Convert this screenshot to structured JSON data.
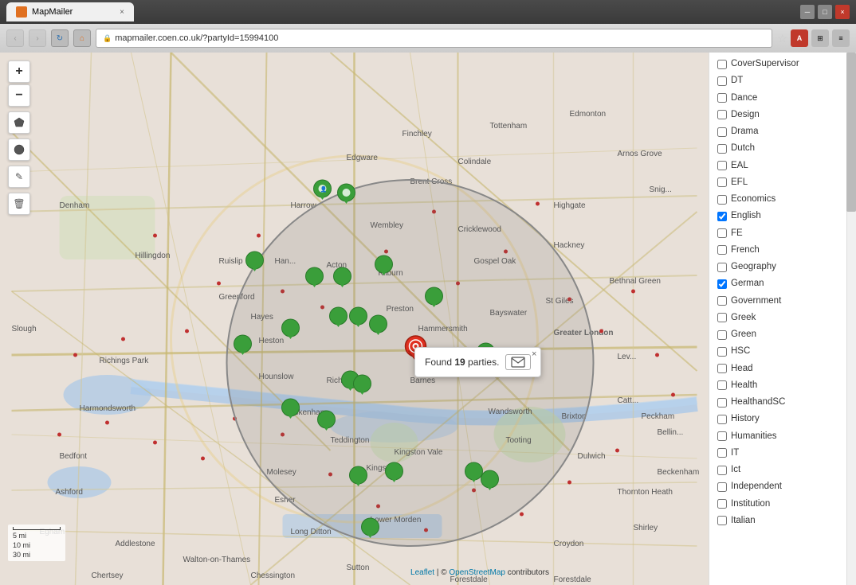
{
  "browser": {
    "tab_title": "MapMailer",
    "tab_close": "×",
    "url": "mapmailer.coen.co.uk/?partyId=15994100",
    "win_min": "─",
    "win_max": "□",
    "win_close": "×"
  },
  "map": {
    "popup": {
      "text": "Found 19 parties.",
      "close": "×"
    },
    "scale": {
      "labels": [
        "5 mi",
        "10 mi",
        "30 mi"
      ]
    },
    "attribution": {
      "leaflet": "Leaflet",
      "separator": " | © ",
      "osm": "OpenStreetMap",
      "contributors": " contributors"
    }
  },
  "sidebar": {
    "items": [
      {
        "id": "CoverSupervisor",
        "label": "CoverSupervisor",
        "checked": false
      },
      {
        "id": "DT",
        "label": "DT",
        "checked": false
      },
      {
        "id": "Dance",
        "label": "Dance",
        "checked": false
      },
      {
        "id": "Design",
        "label": "Design",
        "checked": false
      },
      {
        "id": "Drama",
        "label": "Drama",
        "checked": false
      },
      {
        "id": "Dutch",
        "label": "Dutch",
        "checked": false
      },
      {
        "id": "EAL",
        "label": "EAL",
        "checked": false
      },
      {
        "id": "EFL",
        "label": "EFL",
        "checked": false
      },
      {
        "id": "Economics",
        "label": "Economics",
        "checked": false
      },
      {
        "id": "English",
        "label": "English",
        "checked": true
      },
      {
        "id": "FE",
        "label": "FE",
        "checked": false
      },
      {
        "id": "French",
        "label": "French",
        "checked": false
      },
      {
        "id": "Geography",
        "label": "Geography",
        "checked": false
      },
      {
        "id": "German",
        "label": "German",
        "checked": true
      },
      {
        "id": "Government",
        "label": "Government",
        "checked": false
      },
      {
        "id": "Greek",
        "label": "Greek",
        "checked": false
      },
      {
        "id": "Green",
        "label": "Green",
        "checked": false
      },
      {
        "id": "HSC",
        "label": "HSC",
        "checked": false
      },
      {
        "id": "Head",
        "label": "Head",
        "checked": false
      },
      {
        "id": "Health",
        "label": "Health",
        "checked": false
      },
      {
        "id": "HealthandSC",
        "label": "HealthandSC",
        "checked": false
      },
      {
        "id": "History",
        "label": "History",
        "checked": false
      },
      {
        "id": "Humanities",
        "label": "Humanities",
        "checked": false
      },
      {
        "id": "IT",
        "label": "IT",
        "checked": false
      },
      {
        "id": "Ict",
        "label": "Ict",
        "checked": false
      },
      {
        "id": "Independent",
        "label": "Independent",
        "checked": false
      },
      {
        "id": "Institution",
        "label": "Institution",
        "checked": false
      },
      {
        "id": "Italian",
        "label": "Italian",
        "checked": false
      }
    ]
  }
}
